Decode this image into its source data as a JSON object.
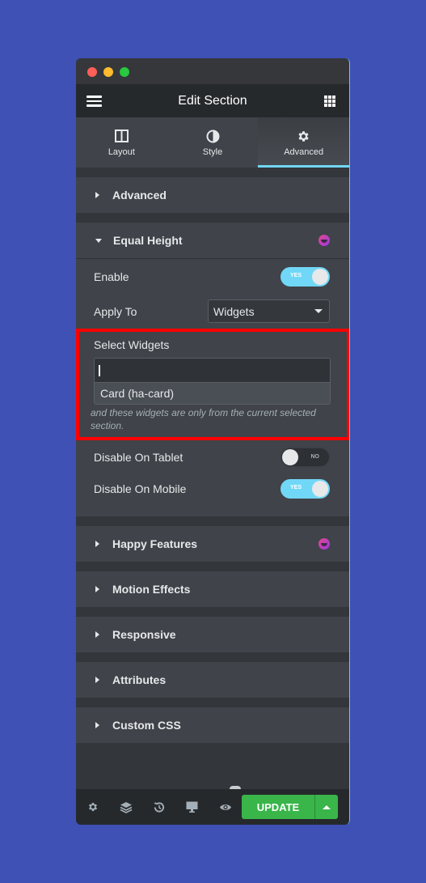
{
  "window": {
    "title": "Edit Section",
    "icons": {
      "menu": "hamburger-icon",
      "apps": "apps-grid-icon"
    }
  },
  "tabs": [
    {
      "label": "Layout",
      "icon": "columns-icon",
      "active": false
    },
    {
      "label": "Style",
      "icon": "half-circle-icon",
      "active": false
    },
    {
      "label": "Advanced",
      "icon": "gear-icon",
      "active": true
    }
  ],
  "sections": {
    "advanced": {
      "label": "Advanced",
      "expanded": false
    },
    "equal_height": {
      "label": "Equal Height",
      "expanded": true,
      "badge_icon": "happy-addons-icon",
      "enable": {
        "label": "Enable",
        "value": "YES",
        "on": true
      },
      "apply_to": {
        "label": "Apply To",
        "value": "Widgets"
      },
      "select_widgets": {
        "label": "Select Widgets",
        "input_value": "",
        "option": "Card (ha-card)",
        "hint": "and these widgets are only from the current selected section."
      },
      "disable_tablet": {
        "label": "Disable On Tablet",
        "value": "NO",
        "on": false
      },
      "disable_mobile": {
        "label": "Disable On Mobile",
        "value": "YES",
        "on": true
      }
    },
    "collapsed": [
      {
        "label": "Happy Features",
        "badge": true
      },
      {
        "label": "Motion Effects",
        "badge": false
      },
      {
        "label": "Responsive",
        "badge": false
      },
      {
        "label": "Attributes",
        "badge": false
      },
      {
        "label": "Custom CSS",
        "badge": false
      }
    ]
  },
  "footer": {
    "icons": [
      "settings-icon",
      "layers-icon",
      "history-icon",
      "responsive-desktop-icon",
      "preview-eye-icon"
    ],
    "update_label": "UPDATE"
  },
  "colors": {
    "accent": "#71d7f7",
    "update_green": "#39b54a",
    "highlight_red": "#ff0000",
    "background": "#3f51b5"
  }
}
